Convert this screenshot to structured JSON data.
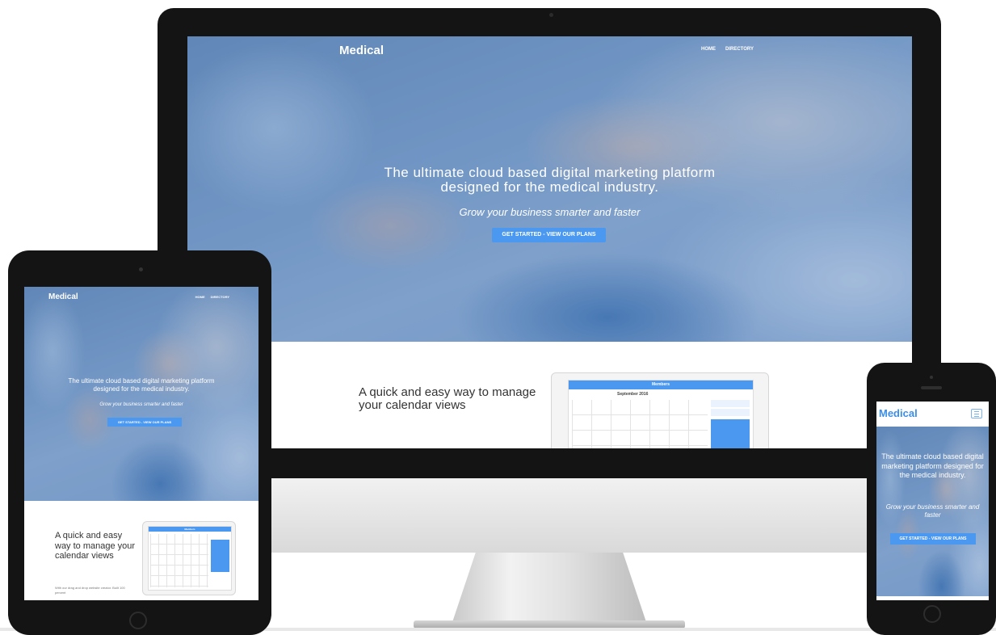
{
  "brand": {
    "logo_text": "Medical",
    "accent_color": "#4a98f0"
  },
  "nav": {
    "items": [
      "HOME",
      "DIRECTORY"
    ]
  },
  "hero": {
    "headline_line1": "The ultimate cloud based digital marketing platform",
    "headline_line2": "designed for the medical industry.",
    "headline_full": "The ultimate cloud based digital marketing platform designed for the medical industry.",
    "tagline": "Grow your business smarter and faster",
    "cta_label": "GET STARTED - VIEW OUR PLANS"
  },
  "feature": {
    "title": "A quick and easy way to manage your calendar views",
    "body_partial": "With our drag and drop website creator. Built 100 percent"
  },
  "calendar_mock": {
    "bar_title": "Members",
    "month_label": "September 2016"
  },
  "icons": {
    "menu": "hamburger-icon"
  }
}
